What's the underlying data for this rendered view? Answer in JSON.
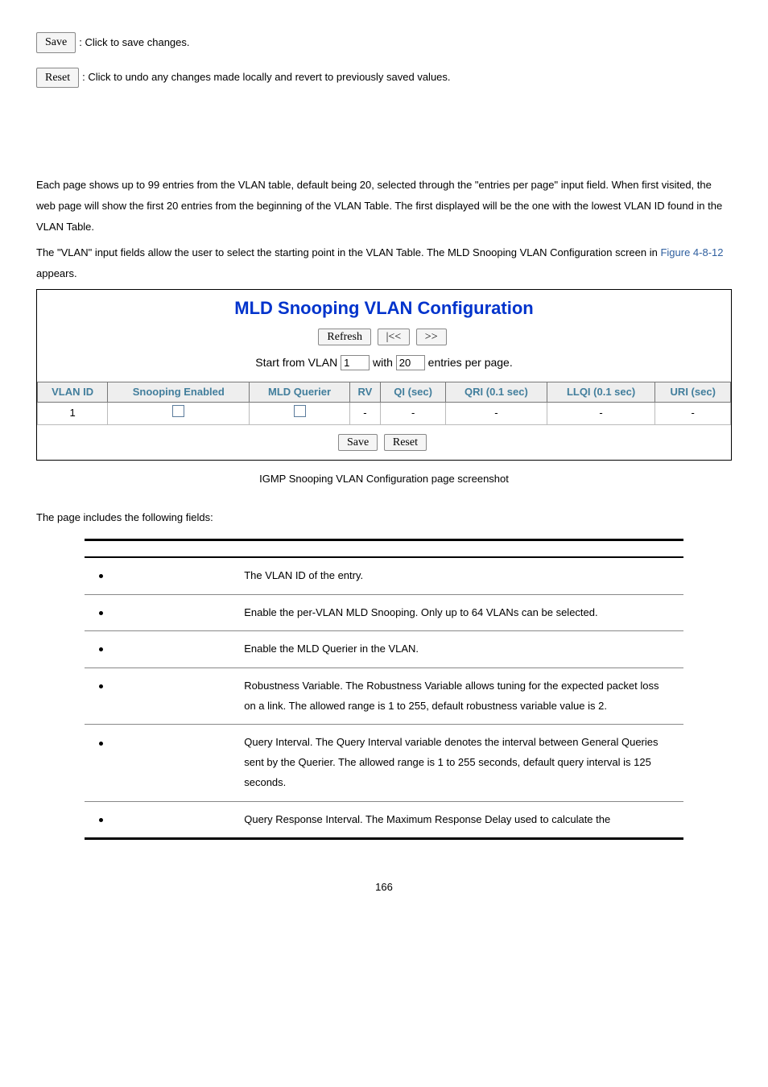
{
  "top_buttons": {
    "save": {
      "label": "Save",
      "desc": ": Click to save changes."
    },
    "reset": {
      "label": "Reset",
      "desc": ": Click to undo any changes made locally and revert to previously saved values."
    }
  },
  "intro": {
    "p1": "Each page shows up to 99 entries from the VLAN table, default being 20, selected through the \"entries per page\" input field. When first visited, the web page will show the first 20 entries from the beginning of the VLAN Table. The first displayed will be the one with the lowest VLAN ID found in the VLAN Table.",
    "p2a": "The \"VLAN\" input fields allow the user to select the starting point in the VLAN Table. The MLD Snooping VLAN Configuration screen in ",
    "figure": "Figure 4-8-12",
    "p2b": " appears."
  },
  "panel": {
    "title": "MLD Snooping VLAN Configuration",
    "refresh": "Refresh",
    "prev": "|<<",
    "next": ">>",
    "start_label": "Start from VLAN ",
    "start_value": "1",
    "with_label": " with ",
    "with_value": "20",
    "entries_label": " entries per page.",
    "headers": {
      "vlan": "VLAN ID",
      "snoop": "Snooping Enabled",
      "mld": "MLD Querier",
      "rv": "RV",
      "qi": "QI (sec)",
      "qri": "QRI (0.1 sec)",
      "llqi": "LLQI (0.1 sec)",
      "uri": "URI (sec)"
    },
    "row": {
      "vlan": "1",
      "rv": "-",
      "qi": "-",
      "qri": "-",
      "llqi": "-",
      "uri": "-"
    },
    "save": "Save",
    "reset": "Reset"
  },
  "caption": "IGMP Snooping VLAN Configuration page screenshot",
  "fields_intro": "The page includes the following fields:",
  "fields": {
    "vlanid": "The VLAN ID of the entry.",
    "snoop": "Enable the per-VLAN MLD Snooping. Only up to 64 VLANs can be selected.",
    "mld": "Enable the MLD Querier in the VLAN.",
    "rv": "Robustness Variable. The Robustness Variable allows tuning for the expected packet loss on a link. The allowed range is 1 to 255, default robustness variable value is 2.",
    "qi": "Query Interval. The Query Interval variable denotes the interval between General Queries sent by the Querier. The allowed range is 1 to 255 seconds, default query interval is 125 seconds.",
    "qri": "Query Response Interval. The Maximum Response Delay used to calculate the"
  },
  "page_number": "166"
}
